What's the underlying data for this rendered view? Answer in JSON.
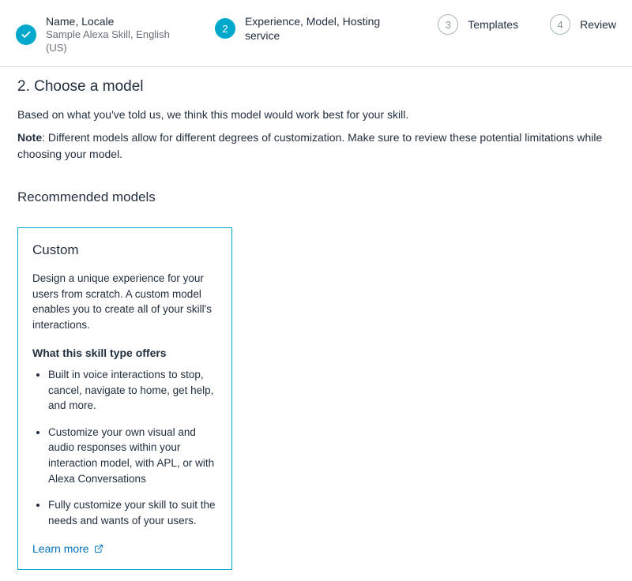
{
  "stepper": {
    "steps": [
      {
        "title": "Name, Locale",
        "sub": "Sample Alexa Skill, English (US)",
        "state": "done"
      },
      {
        "title": "Experience, Model, Hosting service",
        "sub": "",
        "state": "active",
        "num": "2"
      },
      {
        "title": "Templates",
        "sub": "",
        "state": "pending",
        "num": "3"
      },
      {
        "title": "Review",
        "sub": "",
        "state": "pending",
        "num": "4"
      }
    ]
  },
  "section": {
    "heading": "2. Choose a model",
    "intro": "Based on what you've told us, we think this model would work best for your skill.",
    "note_label": "Note",
    "note_text": ": Different models allow for different degrees of customization. Make sure to review these potential limitations while choosing your model."
  },
  "recommended": {
    "heading": "Recommended models",
    "card": {
      "title": "Custom",
      "desc": "Design a unique experience for your users from scratch. A custom model enables you to create all of your skill's interactions.",
      "offers_heading": "What this skill type offers",
      "offers": [
        "Built in voice interactions to stop, cancel, navigate to home, get help, and more.",
        "Customize your own visual and audio responses within your interaction model, with APL, or with Alexa Conversations",
        "Fully customize your skill to suit the needs and wants of your users."
      ],
      "learn_more": "Learn more"
    }
  }
}
